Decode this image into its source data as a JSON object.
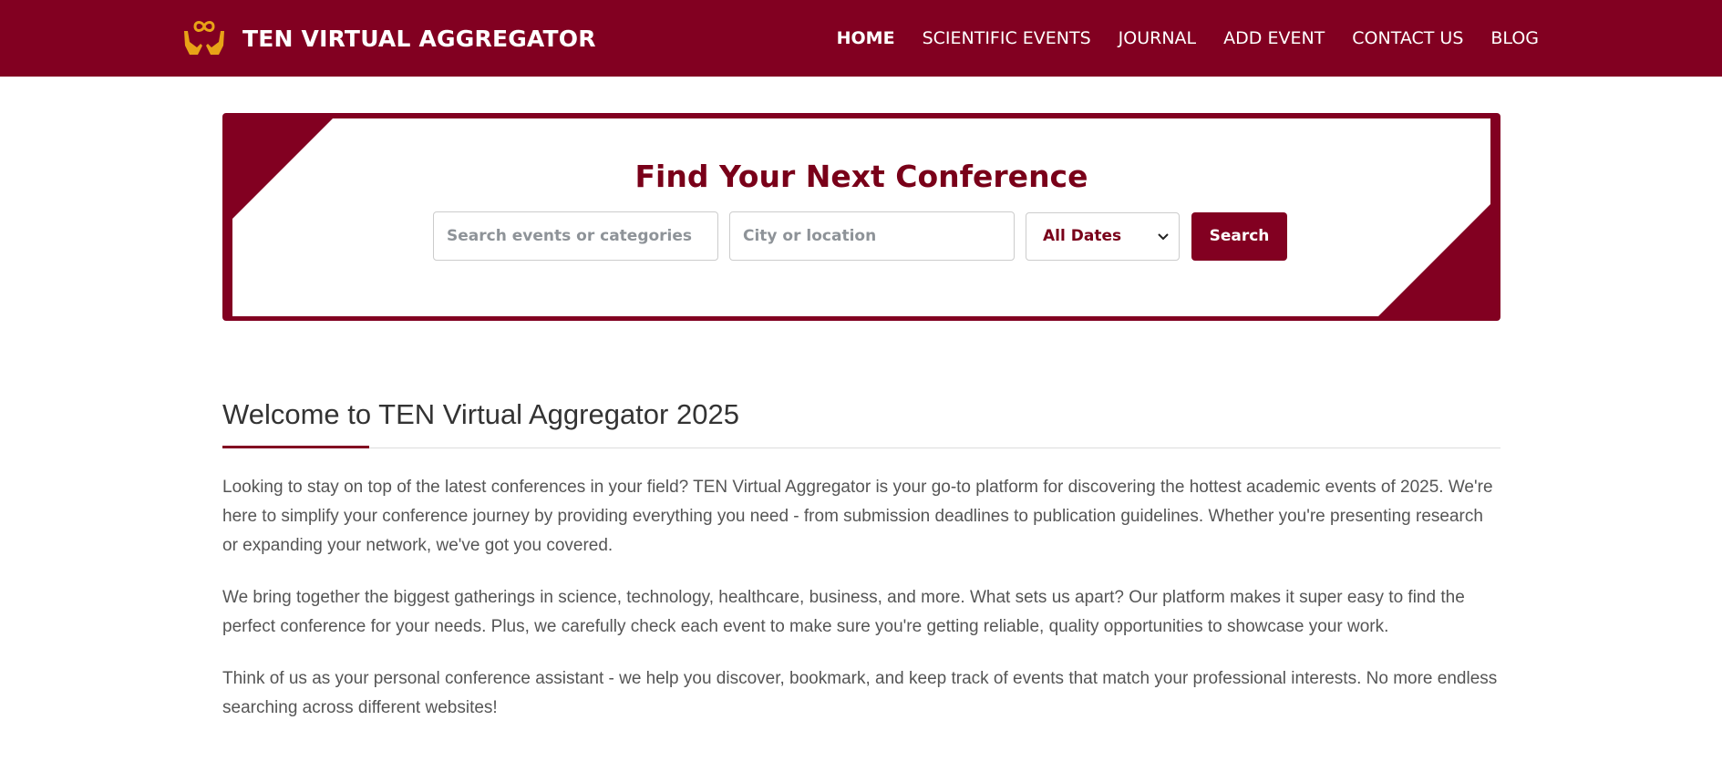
{
  "brand": {
    "name": "TEN VIRTUAL AGGREGATOR",
    "logo_icon": "hands-infinity-icon",
    "logo_color": "#e8a317"
  },
  "nav": {
    "items": [
      {
        "label": "HOME",
        "active": true
      },
      {
        "label": "SCIENTIFIC EVENTS",
        "active": false
      },
      {
        "label": "JOURNAL",
        "active": false
      },
      {
        "label": "ADD EVENT",
        "active": false
      },
      {
        "label": "CONTACT US",
        "active": false
      },
      {
        "label": "BLOG",
        "active": false
      }
    ]
  },
  "hero": {
    "title": "Find Your Next Conference",
    "events_placeholder": "Search events or categories",
    "events_value": "",
    "city_placeholder": "City or location",
    "city_value": "",
    "date_selected": "All Dates",
    "search_label": "Search"
  },
  "welcome": {
    "title": "Welcome to TEN Virtual Aggregator 2025",
    "paragraphs": [
      "Looking to stay on top of the latest conferences in your field? TEN Virtual Aggregator is your go-to platform for discovering the hottest academic events of 2025. We're here to simplify your conference journey by providing everything you need - from submission deadlines to publication guidelines. Whether you're presenting research or expanding your network, we've got you covered.",
      "We bring together the biggest gatherings in science, technology, healthcare, business, and more. What sets us apart? Our platform makes it super easy to find the perfect conference for your needs. Plus, we carefully check each event to make sure you're getting reliable, quality opportunities to showcase your work.",
      "Think of us as your personal conference assistant - we help you discover, bookmark, and keep track of events that match your professional interests. No more endless searching across different websites!"
    ]
  },
  "colors": {
    "primary": "#820021",
    "heading": "#790019",
    "body_text": "#555555",
    "white": "#ffffff"
  }
}
